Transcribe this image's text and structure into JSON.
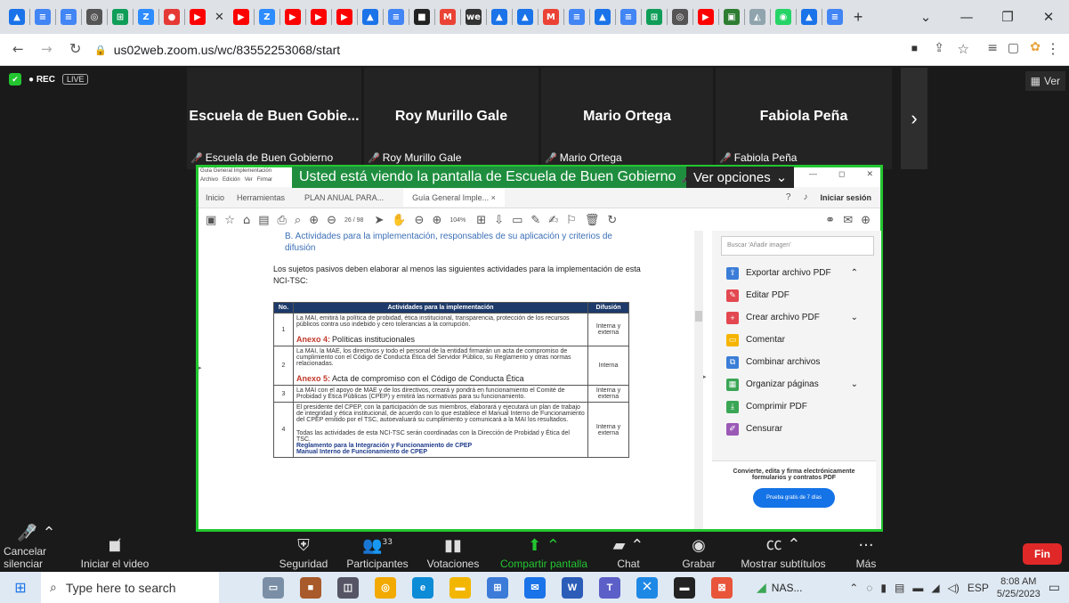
{
  "browser": {
    "url": "us02web.zoom.us/wc/83552253068/start",
    "tabs_icons": [
      {
        "name": "drive-tab-icon",
        "color": "#1a73e8",
        "glyph": "▲"
      },
      {
        "name": "docs-tab-icon",
        "color": "#4285f4",
        "glyph": "≡"
      },
      {
        "name": "docs-tab-icon",
        "color": "#4285f4",
        "glyph": "≡"
      },
      {
        "name": "chrome-tab-icon",
        "color": "#555",
        "glyph": "◎"
      },
      {
        "name": "sheets-tab-icon",
        "color": "#0f9d58",
        "glyph": "⊞"
      },
      {
        "name": "zoom-tab-icon",
        "color": "#2d8cff",
        "glyph": "Z"
      },
      {
        "name": "record-tab-icon",
        "color": "#e53935",
        "glyph": "●"
      },
      {
        "name": "youtube-tab-icon",
        "color": "#ff0000",
        "glyph": "▶"
      }
    ],
    "tabs_icons_right": [
      {
        "name": "youtube-tab-icon",
        "color": "#ff0000",
        "glyph": "▶"
      },
      {
        "name": "zoom-tab-icon",
        "color": "#2d8cff",
        "glyph": "Z"
      },
      {
        "name": "youtube-tab-icon",
        "color": "#ff0000",
        "glyph": "▶"
      },
      {
        "name": "youtube-tab-icon",
        "color": "#ff0000",
        "glyph": "▶"
      },
      {
        "name": "youtube-tab-icon",
        "color": "#ff0000",
        "glyph": "▶"
      },
      {
        "name": "drive-tab-icon",
        "color": "#1a73e8",
        "glyph": "▲"
      },
      {
        "name": "docs-tab-icon",
        "color": "#4285f4",
        "glyph": "≡"
      },
      {
        "name": "app-tab-icon",
        "color": "#222",
        "glyph": "■"
      },
      {
        "name": "gmail-tab-icon",
        "color": "#ea4335",
        "glyph": "M"
      },
      {
        "name": "we-tab-icon",
        "color": "#333",
        "glyph": "we"
      },
      {
        "name": "drive-tab-icon",
        "color": "#1a73e8",
        "glyph": "▲"
      },
      {
        "name": "drive-tab-icon",
        "color": "#1a73e8",
        "glyph": "▲"
      },
      {
        "name": "gmail-tab-icon",
        "color": "#ea4335",
        "glyph": "M"
      },
      {
        "name": "docs-tab-icon",
        "color": "#4285f4",
        "glyph": "≡"
      },
      {
        "name": "drive-tab-icon",
        "color": "#1a73e8",
        "glyph": "▲"
      },
      {
        "name": "docs-tab-icon",
        "color": "#4285f4",
        "glyph": "≡"
      },
      {
        "name": "sheets-tab-icon",
        "color": "#0f9d58",
        "glyph": "⊞"
      },
      {
        "name": "chrome-tab-icon",
        "color": "#555",
        "glyph": "◎"
      },
      {
        "name": "youtube-tab-icon",
        "color": "#ff0000",
        "glyph": "▶"
      },
      {
        "name": "meet-tab-icon",
        "color": "#2e7d32",
        "glyph": "▣"
      },
      {
        "name": "drawing-tab-icon",
        "color": "#90a4ae",
        "glyph": "◭"
      },
      {
        "name": "whatsapp-tab-icon",
        "color": "#25d366",
        "glyph": "◉"
      },
      {
        "name": "drive-tab-icon",
        "color": "#1a73e8",
        "glyph": "▲"
      },
      {
        "name": "docs-tab-icon",
        "color": "#4285f4",
        "glyph": "≡"
      }
    ]
  },
  "zoom": {
    "rec": "● REC",
    "live": "LIVE",
    "view_label": "Ver",
    "participants": [
      {
        "name": "Escuela de Buen Gobie...",
        "label": "Escuela de Buen Gobierno"
      },
      {
        "name": "Roy Murillo Gale",
        "label": "Roy Murillo Gale"
      },
      {
        "name": "Mario Ortega",
        "label": "Mario Ortega"
      },
      {
        "name": "Fabiola Peña",
        "label": "Fabiola Peña"
      }
    ],
    "share_banner": "Usted está viendo la pantalla de Escuela de Buen Gobierno",
    "view_options": "Ver opciones",
    "toolbar": {
      "mute": "Cancelar silenciar",
      "video": "Iniciar el video",
      "security": "Seguridad",
      "participants": "Participantes",
      "participants_count": "33",
      "polls": "Votaciones",
      "share": "Compartir pantalla",
      "chat": "Chat",
      "record": "Grabar",
      "captions": "Mostrar subtítulos",
      "more": "Más",
      "end": "Fin"
    }
  },
  "acrobat": {
    "window_title": "Guía General Implementación",
    "menu": [
      "Archivo",
      "Edición",
      "Ver",
      "Firmar"
    ],
    "tabs": [
      "Inicio",
      "Herramientas",
      "PLAN ANUAL PARA...",
      "Guía General Imple..."
    ],
    "sign_in": "Iniciar sesión",
    "page_nav": "26 / 98",
    "zoom": "104%",
    "search_placeholder": "Buscar 'Añadir imagen'",
    "tools": [
      {
        "label": "Exportar archivo PDF",
        "color": "#3b7dd8",
        "glyph": "⇪",
        "expand": "⌃"
      },
      {
        "label": "Editar PDF",
        "color": "#e34850",
        "glyph": "✎",
        "expand": ""
      },
      {
        "label": "Crear archivo PDF",
        "color": "#e34850",
        "glyph": "+",
        "expand": "⌄"
      },
      {
        "label": "Comentar",
        "color": "#f5b400",
        "glyph": "▭",
        "expand": ""
      },
      {
        "label": "Combinar archivos",
        "color": "#3b7dd8",
        "glyph": "⧉",
        "expand": ""
      },
      {
        "label": "Organizar páginas",
        "color": "#3aa655",
        "glyph": "▦",
        "expand": "⌄"
      },
      {
        "label": "Comprimir PDF",
        "color": "#3aa655",
        "glyph": "⤓",
        "expand": ""
      },
      {
        "label": "Censurar",
        "color": "#9b59b6",
        "glyph": "✐",
        "expand": ""
      }
    ],
    "promo": "Convierte, edita y firma electrónicamente formularios y contratos PDF",
    "promo_button": "Prueba gratis de 7 días"
  },
  "document": {
    "section_heading": "B.  Actividades para la implementación, responsables de su aplicación y criterios de difusión",
    "intro": "Los sujetos pasivos deben elaborar al menos las siguientes actividades para la implementación de esta NCI-TSC:",
    "table_headers": [
      "No.",
      "Actividades para la implementación",
      "Difusión"
    ],
    "rows": [
      {
        "no": "1",
        "text": "La MAI, emitirá la política de probidad, ética institucional, transparencia, protección de los recursos públicos contra uso indebido y cero tolerancias a la corrupción.",
        "annex": "Anexo 4:",
        "annex_text": "Políticas institucionales",
        "links": [],
        "difusion": "Interna y externa"
      },
      {
        "no": "2",
        "text": "La MAI, la MAE, los directivos y todo el personal de la entidad firmarán un acta de compromiso de cumplimiento con el Código de Conducta Ética del Servidor Público, su Reglamento y otras normas relacionadas.",
        "annex": "Anexo 5:",
        "annex_text": "Acta de compromiso con el Código de Conducta Ética",
        "links": [],
        "difusion": "Interna"
      },
      {
        "no": "3",
        "text": "La MAI con el apoyo de MAE y de los directivos, creará y pondrá en funcionamiento el Comité de Probidad y Ética Públicas (CPEP) y emitirá las normativas para su funcionamiento.",
        "annex": "",
        "annex_text": "",
        "links": [],
        "difusion": "Interna y externa"
      },
      {
        "no": "4",
        "text": "El presidente del CPEP, con la participación de sus miembros, elaborará y ejecutará un plan de trabajo de integridad y ética institucional, de acuerdo con lo que establece el Manual Interno de Funcionamiento del CPEP emitido por el TSC, autoevaluará su cumplimiento y comunicará a la MAI los resultados.",
        "text2": "Todas las actividades de esta NCI-TSC serán coordinadas con la Dirección de Probidad y Ética del TSC.",
        "annex": "",
        "annex_text": "",
        "links": [
          "Reglamento para la Integración y Funcionamiento de CPEP",
          "Manual Interno de Funcionamiento de CPEP"
        ],
        "difusion": "Interna y externa"
      }
    ]
  },
  "taskbar": {
    "search_placeholder": "Type here to search",
    "nas": "NAS...",
    "lang": "ESP",
    "time": "8:08 AM",
    "date": "5/25/2023"
  }
}
